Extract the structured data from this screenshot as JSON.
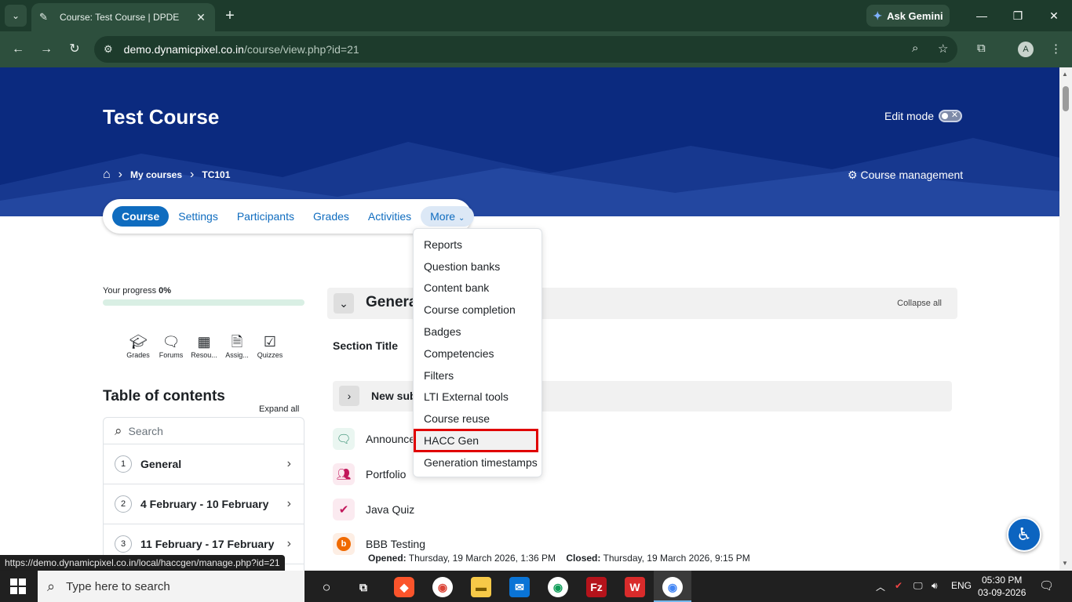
{
  "browser": {
    "tab_title": "Course: Test Course | DPDE",
    "tab_close": "✕",
    "new_tab": "+",
    "gemini_label": "Ask Gemini",
    "url_host": "demo.dynamicpixel.co.in",
    "url_path": "/course/view.php?id=21",
    "profile_initial": "A"
  },
  "header": {
    "course_title": "Test Course",
    "edit_mode_label": "Edit mode",
    "breadcrumb": [
      "My courses",
      "TC101"
    ],
    "course_management": "Course management"
  },
  "secondary_nav": {
    "items": [
      "Course",
      "Settings",
      "Participants",
      "Grades",
      "Activities"
    ],
    "more_label": "More"
  },
  "more_menu": {
    "items": [
      "Reports",
      "Question banks",
      "Content bank",
      "Course completion",
      "Badges",
      "Competencies",
      "Filters",
      "LTI External tools",
      "Course reuse",
      "HACC Gen",
      "Generation timestamps"
    ],
    "highlighted_index": 9
  },
  "sidebar": {
    "progress_label": "Your progress",
    "progress_value": "0%",
    "shortcuts": [
      "Grades",
      "Forums",
      "Resou...",
      "Assig...",
      "Quizzes"
    ],
    "toc_title": "Table of contents",
    "expand_all": "Expand all",
    "search_placeholder": "Search",
    "toc_items": [
      {
        "num": "1",
        "label": "General"
      },
      {
        "num": "2",
        "label": "4 February - 10 February"
      },
      {
        "num": "3",
        "label": "11 February - 17 February"
      }
    ]
  },
  "main": {
    "section_name": "General",
    "collapse_all": "Collapse all",
    "section_title": "Section Title",
    "subsection_title": "New sub",
    "activities": [
      "Announce",
      "Portfolio",
      "Java Quiz",
      "BBB Testing"
    ],
    "bbb_opened_label": "Opened:",
    "bbb_opened_value": "Thursday, 19 March 2026, 1:36 PM",
    "bbb_closed_label": "Closed:",
    "bbb_closed_value": "Thursday, 19 March 2026, 9:15 PM"
  },
  "status_url": "https://demo.dynamicpixel.co.in/local/haccgen/manage.php?id=21",
  "taskbar": {
    "search_placeholder": "Type here to search",
    "lang": "ENG",
    "time": "05:30 PM",
    "date": "03-09-2026"
  },
  "colors": {
    "banner": "#0b2a7f",
    "primary": "#0f6cbf",
    "highlight_border": "#e00000"
  }
}
